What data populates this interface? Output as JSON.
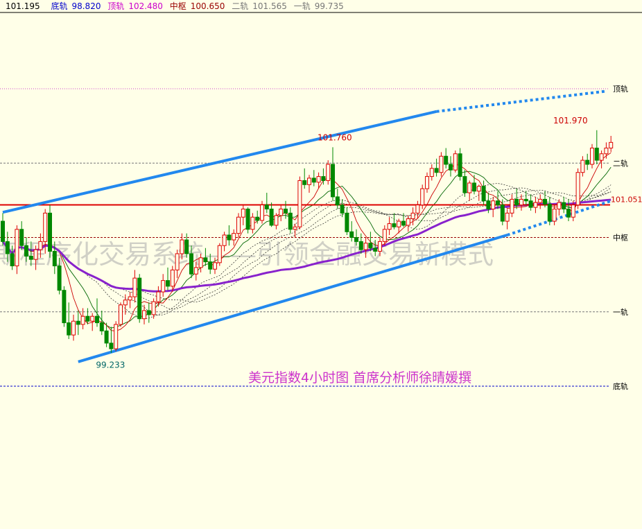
{
  "header": {
    "price": "101.195",
    "items": [
      {
        "label": "底轨",
        "value": "98.820",
        "color": "#0000cc"
      },
      {
        "label": "顶轨",
        "value": "102.480",
        "color": "#cc00cc"
      },
      {
        "label": "中枢",
        "value": "100.650",
        "color": "#990000"
      },
      {
        "label": "二轨",
        "value": "101.565",
        "color": "#777777"
      },
      {
        "label": "一轨",
        "value": "99.735",
        "color": "#777777"
      }
    ]
  },
  "watermark": "期程序化交易系统——引领金融交易新模式",
  "caption": "美元指数4小时图    首席分析师徐晴媛撰",
  "chart_data": {
    "type": "candlestick",
    "y_range": [
      98.5,
      102.8
    ],
    "levels": [
      {
        "name": "顶轨",
        "value": 102.48,
        "color": "#cc44cc",
        "style": "dotted"
      },
      {
        "name": "二轨",
        "value": 101.565,
        "color": "#777777",
        "style": "dashed"
      },
      {
        "name": "中枢",
        "value": 100.65,
        "color": "#990000",
        "style": "dashed"
      },
      {
        "name": "一轨",
        "value": 99.735,
        "color": "#777777",
        "style": "dashed"
      },
      {
        "name": "底轨",
        "value": 98.82,
        "color": "#0000cc",
        "style": "dashed"
      }
    ],
    "horizontal_line": {
      "value": 101.051,
      "label": "101.051",
      "color": "#dd0000"
    },
    "annotations": [
      {
        "text": "101.760",
        "bar": 70,
        "value": 101.76,
        "color": "#cc0000"
      },
      {
        "text": "101.970",
        "bar": 120,
        "value": 101.97,
        "color": "#cc0000"
      },
      {
        "text": "99.233",
        "bar": 23,
        "value": 99.233,
        "color": "#006666"
      }
    ],
    "trendlines": [
      {
        "from": [
          0,
          100.96
        ],
        "to": [
          92,
          102.2
        ],
        "style": "solid",
        "color": "#2288ee"
      },
      {
        "from": [
          92,
          102.2
        ],
        "to": [
          128,
          102.45
        ],
        "style": "dotted",
        "color": "#2288ee"
      },
      {
        "from": [
          16,
          99.12
        ],
        "to": [
          107,
          100.68
        ],
        "style": "solid",
        "color": "#2288ee"
      },
      {
        "from": [
          107,
          100.68
        ],
        "to": [
          129,
          101.1
        ],
        "style": "dotted",
        "color": "#2288ee"
      }
    ],
    "candles": [
      [
        100.85,
        100.95,
        100.55,
        100.6
      ],
      [
        100.6,
        100.72,
        100.35,
        100.45
      ],
      [
        100.45,
        100.55,
        100.25,
        100.3
      ],
      [
        100.3,
        100.8,
        100.2,
        100.75
      ],
      [
        100.75,
        100.85,
        100.5,
        100.55
      ],
      [
        100.55,
        100.65,
        100.35,
        100.42
      ],
      [
        100.42,
        100.6,
        100.3,
        100.38
      ],
      [
        100.38,
        100.55,
        100.25,
        100.5
      ],
      [
        100.5,
        100.7,
        100.4,
        100.6
      ],
      [
        100.6,
        101.0,
        100.45,
        100.95
      ],
      [
        100.95,
        101.05,
        100.4,
        100.48
      ],
      [
        100.48,
        100.6,
        100.2,
        100.3
      ],
      [
        100.3,
        100.4,
        99.95,
        100.0
      ],
      [
        100.0,
        100.05,
        99.55,
        99.6
      ],
      [
        99.6,
        99.85,
        99.4,
        99.45
      ],
      [
        99.45,
        99.7,
        99.38,
        99.62
      ],
      [
        99.62,
        99.75,
        99.45,
        99.58
      ],
      [
        99.58,
        99.78,
        99.52,
        99.68
      ],
      [
        99.68,
        99.78,
        99.58,
        99.62
      ],
      [
        99.62,
        99.72,
        99.5,
        99.68
      ],
      [
        99.68,
        99.9,
        99.55,
        99.6
      ],
      [
        99.6,
        99.75,
        99.45,
        99.5
      ],
      [
        99.5,
        99.6,
        99.3,
        99.35
      ],
      [
        99.35,
        99.55,
        99.23,
        99.28
      ],
      [
        99.28,
        99.62,
        99.25,
        99.58
      ],
      [
        99.58,
        99.85,
        99.55,
        99.82
      ],
      [
        99.82,
        99.95,
        99.7,
        99.88
      ],
      [
        99.88,
        99.98,
        99.78,
        99.92
      ],
      [
        99.92,
        100.25,
        99.85,
        100.15
      ],
      [
        100.15,
        100.2,
        99.6,
        99.65
      ],
      [
        99.65,
        99.82,
        99.58,
        99.75
      ],
      [
        99.75,
        99.85,
        99.6,
        99.7
      ],
      [
        99.7,
        99.9,
        99.65,
        99.86
      ],
      [
        99.86,
        100.05,
        99.8,
        99.98
      ],
      [
        99.98,
        100.2,
        99.92,
        100.12
      ],
      [
        100.12,
        100.28,
        100.0,
        100.05
      ],
      [
        100.05,
        100.3,
        99.98,
        100.25
      ],
      [
        100.25,
        100.5,
        100.15,
        100.45
      ],
      [
        100.45,
        100.7,
        100.38,
        100.62
      ],
      [
        100.62,
        100.7,
        100.4,
        100.45
      ],
      [
        100.45,
        100.55,
        100.15,
        100.2
      ],
      [
        100.2,
        100.35,
        100.12,
        100.28
      ],
      [
        100.28,
        100.45,
        100.22,
        100.4
      ],
      [
        100.4,
        100.52,
        100.3,
        100.35
      ],
      [
        100.35,
        100.45,
        100.2,
        100.26
      ],
      [
        100.26,
        100.4,
        100.2,
        100.34
      ],
      [
        100.34,
        100.58,
        100.3,
        100.55
      ],
      [
        100.55,
        100.72,
        100.48,
        100.68
      ],
      [
        100.68,
        100.8,
        100.55,
        100.62
      ],
      [
        100.62,
        100.75,
        100.55,
        100.7
      ],
      [
        100.7,
        100.95,
        100.65,
        100.9
      ],
      [
        100.9,
        101.05,
        100.8,
        101.0
      ],
      [
        101.0,
        101.02,
        100.7,
        100.75
      ],
      [
        100.75,
        100.95,
        100.7,
        100.9
      ],
      [
        100.9,
        100.98,
        100.82,
        100.86
      ],
      [
        100.86,
        101.1,
        100.82,
        101.05
      ],
      [
        101.05,
        101.2,
        100.95,
        101.0
      ],
      [
        101.0,
        101.08,
        100.78,
        100.8
      ],
      [
        100.8,
        100.95,
        100.75,
        100.92
      ],
      [
        100.92,
        101.05,
        100.85,
        101.0
      ],
      [
        101.0,
        101.1,
        100.88,
        100.95
      ],
      [
        100.95,
        101.02,
        100.7,
        100.75
      ],
      [
        100.75,
        100.82,
        100.65,
        100.78
      ],
      [
        100.78,
        101.4,
        100.75,
        101.35
      ],
      [
        101.35,
        101.5,
        101.25,
        101.3
      ],
      [
        101.3,
        101.42,
        101.2,
        101.38
      ],
      [
        101.38,
        101.48,
        101.28,
        101.33
      ],
      [
        101.33,
        101.45,
        101.25,
        101.4
      ],
      [
        101.4,
        101.5,
        101.3,
        101.35
      ],
      [
        101.35,
        101.6,
        101.3,
        101.55
      ],
      [
        101.55,
        101.76,
        101.1,
        101.15
      ],
      [
        101.15,
        101.25,
        101.0,
        101.05
      ],
      [
        101.05,
        101.12,
        100.9,
        100.95
      ],
      [
        100.95,
        101.02,
        100.68,
        100.72
      ],
      [
        100.72,
        100.85,
        100.6,
        100.65
      ],
      [
        100.65,
        100.75,
        100.55,
        100.6
      ],
      [
        100.6,
        100.7,
        100.45,
        100.5
      ],
      [
        100.5,
        100.65,
        100.4,
        100.58
      ],
      [
        100.58,
        100.72,
        100.48,
        100.52
      ],
      [
        100.52,
        100.62,
        100.42,
        100.48
      ],
      [
        100.48,
        100.65,
        100.42,
        100.6
      ],
      [
        100.6,
        100.8,
        100.55,
        100.75
      ],
      [
        100.75,
        100.9,
        100.68,
        100.82
      ],
      [
        100.82,
        100.95,
        100.75,
        100.78
      ],
      [
        100.78,
        100.88,
        100.7,
        100.85
      ],
      [
        100.85,
        100.95,
        100.78,
        100.8
      ],
      [
        100.8,
        100.92,
        100.72,
        100.88
      ],
      [
        100.88,
        101.02,
        100.8,
        100.95
      ],
      [
        100.95,
        101.1,
        100.88,
        101.05
      ],
      [
        101.05,
        101.3,
        101.0,
        101.25
      ],
      [
        101.25,
        101.45,
        101.2,
        101.4
      ],
      [
        101.4,
        101.55,
        101.35,
        101.5
      ],
      [
        101.5,
        101.62,
        101.4,
        101.45
      ],
      [
        101.45,
        101.7,
        101.4,
        101.65
      ],
      [
        101.65,
        101.75,
        101.5,
        101.55
      ],
      [
        101.55,
        101.65,
        101.4,
        101.48
      ],
      [
        101.48,
        101.72,
        101.45,
        101.68
      ],
      [
        101.68,
        101.75,
        101.35,
        101.4
      ],
      [
        101.4,
        101.48,
        101.15,
        101.2
      ],
      [
        101.2,
        101.35,
        101.1,
        101.32
      ],
      [
        101.32,
        101.42,
        101.18,
        101.22
      ],
      [
        101.22,
        101.3,
        101.1,
        101.28
      ],
      [
        101.28,
        101.35,
        101.05,
        101.1
      ],
      [
        101.1,
        101.2,
        100.95,
        101.0
      ],
      [
        101.0,
        101.15,
        100.9,
        101.1
      ],
      [
        101.1,
        101.22,
        101.0,
        101.05
      ],
      [
        101.05,
        101.12,
        100.8,
        100.85
      ],
      [
        100.85,
        101.0,
        100.75,
        100.95
      ],
      [
        100.95,
        101.18,
        100.9,
        101.12
      ],
      [
        101.12,
        101.25,
        101.0,
        101.05
      ],
      [
        101.05,
        101.18,
        100.98,
        101.12
      ],
      [
        101.12,
        101.22,
        101.05,
        101.1
      ],
      [
        101.1,
        101.18,
        100.98,
        101.02
      ],
      [
        101.02,
        101.15,
        100.95,
        101.08
      ],
      [
        101.08,
        101.18,
        101.0,
        101.12
      ],
      [
        101.12,
        101.22,
        101.02,
        101.06
      ],
      [
        101.06,
        101.15,
        100.8,
        100.85
      ],
      [
        100.85,
        101.05,
        100.8,
        101.0
      ],
      [
        101.0,
        101.12,
        100.92,
        101.08
      ],
      [
        101.08,
        101.15,
        100.95,
        101.0
      ],
      [
        101.0,
        101.12,
        100.85,
        100.9
      ],
      [
        100.9,
        101.1,
        100.85,
        101.05
      ],
      [
        101.05,
        101.5,
        101.0,
        101.45
      ],
      [
        101.45,
        101.65,
        101.4,
        101.6
      ],
      [
        101.6,
        101.68,
        101.48,
        101.55
      ],
      [
        101.55,
        101.8,
        101.5,
        101.75
      ],
      [
        101.75,
        101.97,
        101.55,
        101.6
      ],
      [
        101.6,
        101.72,
        101.5,
        101.68
      ],
      [
        101.68,
        101.82,
        101.62,
        101.75
      ],
      [
        101.75,
        101.9,
        101.7,
        101.82
      ]
    ]
  }
}
